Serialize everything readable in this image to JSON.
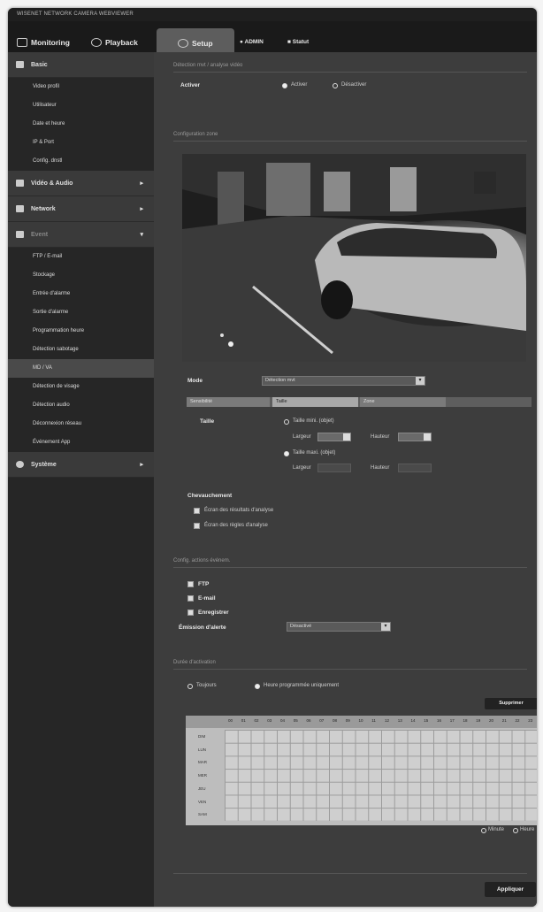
{
  "window": {
    "title": "WISENET NETWORK CAMERA WEBVIEWER"
  },
  "topnav": {
    "monitoring": "Monitoring",
    "playback": "Playback",
    "setup": "Setup",
    "admin": "ADMIN",
    "status": "Statut"
  },
  "sidebar": {
    "basic": "Basic",
    "basic_items": [
      "Video profil",
      "Utilisateur",
      "Date et heure",
      "IP & Port",
      "Config. dnstl"
    ],
    "video_audio": "Vidéo & Audio",
    "network": "Network",
    "event": "Event",
    "event_items": [
      "FTP / E-mail",
      "Stockage",
      "Entrée d'alarme",
      "Sortie d'alarme",
      "Programmation heure",
      "Détection sabotage",
      "MD / VA",
      "Détection de visage",
      "Détection audio",
      "Déconnexion réseau",
      "Événement App"
    ],
    "system": "Système"
  },
  "main": {
    "sec_enable": "Détection mvt / analyse vidéo",
    "activer_label": "Activer",
    "activer_opt": "Activer",
    "desactiver_opt": "Désactiver",
    "sec_config": "Configuration zone",
    "mode_label": "Mode",
    "mode_value": "Détection mvt",
    "tabs": [
      "Sensibilité",
      "Taille",
      "Zone"
    ],
    "taille_label": "Taille",
    "taille_mini": "Taille mini. (objet)",
    "taille_maxi": "Taille maxi. (objet)",
    "largeur": "Largeur",
    "hauteur": "Hauteur",
    "chevauchement_label": "Chevauchement",
    "ecran_resultats": "Écran des résultats d'analyse",
    "ecran_regles": "Écran des règles d'analyse",
    "sec_actions": "Config. actions événem.",
    "ftp": "FTP",
    "email": "E-mail",
    "enregistrer": "Enregistrer",
    "emission_alerte_label": "Émission d'alerte",
    "emission_alerte_value": "Désactivé",
    "sec_schedule": "Durée d'activation",
    "toujours": "Toujours",
    "heure_prog": "Heure programmée uniquement",
    "supprimer": "Supprimer",
    "hours": [
      "00",
      "01",
      "02",
      "03",
      "04",
      "05",
      "06",
      "07",
      "08",
      "09",
      "10",
      "11",
      "12",
      "13",
      "14",
      "15",
      "16",
      "17",
      "18",
      "19",
      "20",
      "21",
      "22",
      "23"
    ],
    "days": [
      "DIM",
      "LUN",
      "MAR",
      "MER",
      "JEU",
      "VEN",
      "SAM"
    ],
    "minute": "Minute",
    "heure": "Heure",
    "appliquer": "Appliquer"
  }
}
